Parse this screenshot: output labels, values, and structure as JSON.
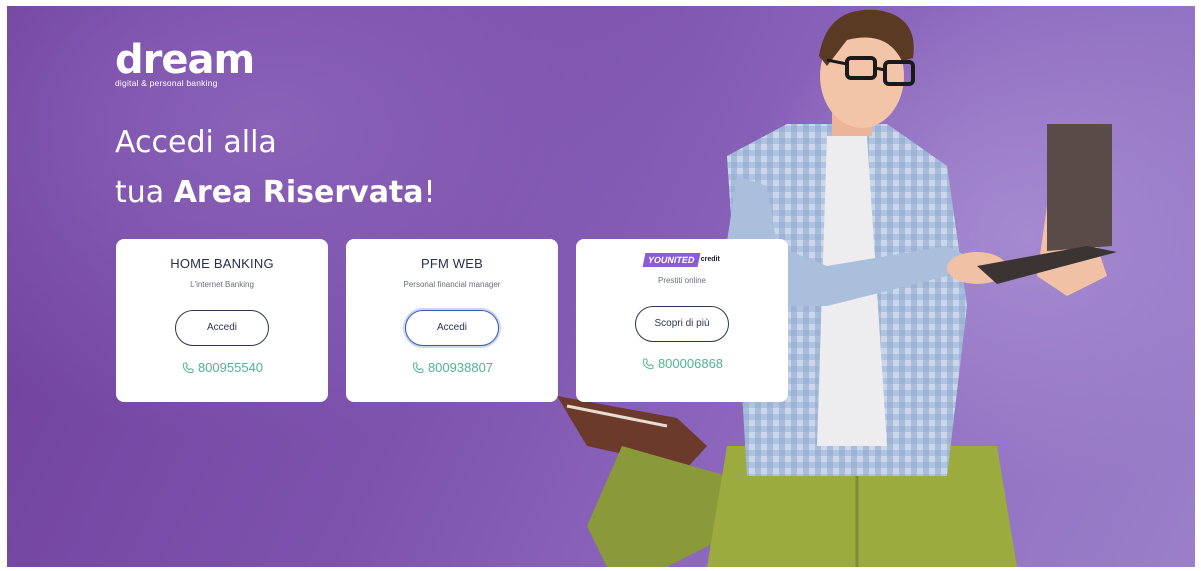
{
  "brand": {
    "name": "dream",
    "tagline": "digital & personal banking"
  },
  "headline": {
    "line1": "Accedi alla",
    "line2_prefix": "tua ",
    "line2_bold": "Area Riservata",
    "line2_suffix": "!"
  },
  "cards": [
    {
      "title": "HOME BANKING",
      "subtitle": "L'internet Banking",
      "button": "Accedi",
      "phone": "800955540"
    },
    {
      "title": "PFM WEB",
      "subtitle": "Personal financial manager",
      "button": "Accedi",
      "phone": "800938807"
    },
    {
      "logo_main": "YOUNITED",
      "logo_sub": "credit",
      "subtitle": "Prestiti online",
      "button": "Scopri di più",
      "phone": "800006868"
    }
  ],
  "colors": {
    "background": "#7a4fab",
    "phone": "#4fb392",
    "button_border": "#2e3552",
    "younited": "#8c5bd8"
  },
  "icons": {
    "phone": "phone-icon"
  }
}
